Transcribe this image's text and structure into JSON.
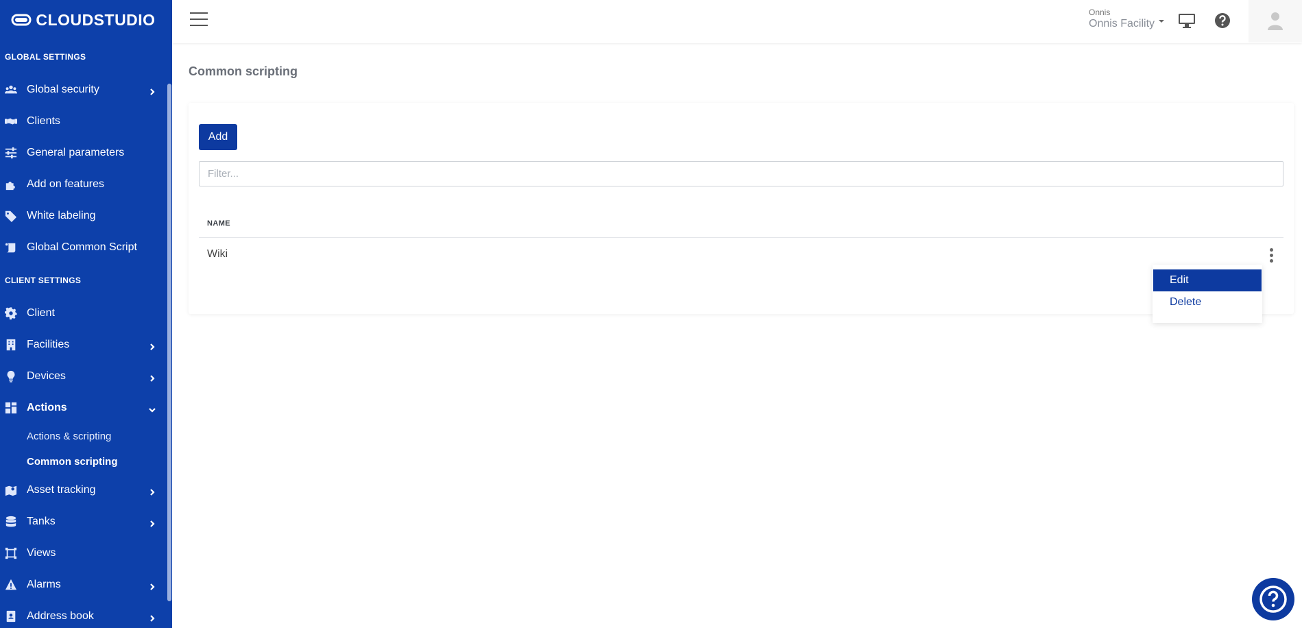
{
  "brand": {
    "name": "CLOUDSTUDIO"
  },
  "sidebar": {
    "global_title": "GLOBAL SETTINGS",
    "global_items": [
      {
        "label": "Global security",
        "icon": "users-icon",
        "has_children": true
      },
      {
        "label": "Clients",
        "icon": "handshake-icon",
        "has_children": false
      },
      {
        "label": "General parameters",
        "icon": "sliders-icon",
        "has_children": false
      },
      {
        "label": "Add on features",
        "icon": "puzzle-icon",
        "has_children": false
      },
      {
        "label": "White labeling",
        "icon": "tag-icon",
        "has_children": false
      },
      {
        "label": "Global Common Script",
        "icon": "scroll-icon",
        "has_children": false
      }
    ],
    "client_title": "CLIENT SETTINGS",
    "client_items": [
      {
        "label": "Client",
        "icon": "gear-icon"
      },
      {
        "label": "Facilities",
        "icon": "building-icon"
      },
      {
        "label": "Devices",
        "icon": "lightbulb-icon"
      },
      {
        "label": "Actions",
        "icon": "grid-icon"
      },
      {
        "label": "Actions & scripting"
      },
      {
        "label": "Common scripting"
      },
      {
        "label": "Asset tracking",
        "icon": "map-icon"
      },
      {
        "label": "Tanks",
        "icon": "database-icon"
      },
      {
        "label": "Views",
        "icon": "frame-icon"
      },
      {
        "label": "Alarms",
        "icon": "warning-icon"
      },
      {
        "label": "Address book",
        "icon": "address-book-icon"
      }
    ]
  },
  "header": {
    "facility_small": "Onnis",
    "facility_name": "Onnis Facility"
  },
  "main": {
    "page_title": "Common scripting",
    "add_label": "Add",
    "filter_placeholder": "Filter...",
    "table": {
      "columns": [
        "NAME"
      ],
      "rows": [
        {
          "name": "Wiki"
        }
      ]
    },
    "context_menu": {
      "items": [
        "Edit",
        "Delete"
      ],
      "selected": "Edit"
    }
  },
  "colors": {
    "sidebar_bg": "#0d40aa",
    "accent": "#0d3aa0"
  }
}
